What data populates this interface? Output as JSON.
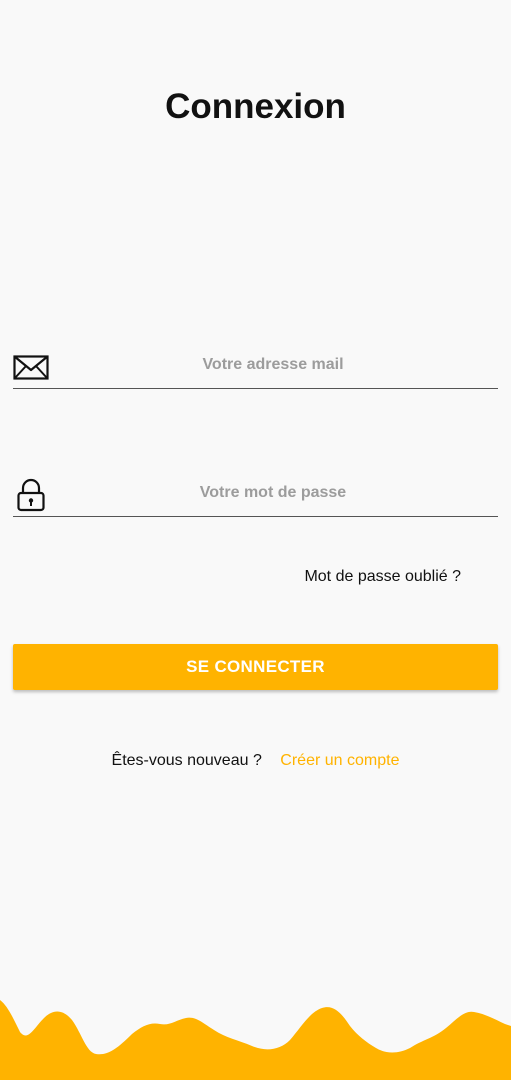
{
  "page": {
    "title": "Connexion"
  },
  "email_field": {
    "placeholder": "Votre adresse mail",
    "icon": "envelope-icon"
  },
  "password_field": {
    "placeholder": "Votre mot de passe",
    "icon": "lock-icon"
  },
  "forgot_password": {
    "label": "Mot de passe oublié ?"
  },
  "login_button": {
    "label": "SE CONNECTER"
  },
  "signup": {
    "question": "Êtes-vous nouveau ?",
    "link_label": "Créer un compte"
  },
  "colors": {
    "accent": "#ffb300",
    "background": "#f9f9f9",
    "text": "#111111",
    "placeholder": "#9c9c9c"
  }
}
